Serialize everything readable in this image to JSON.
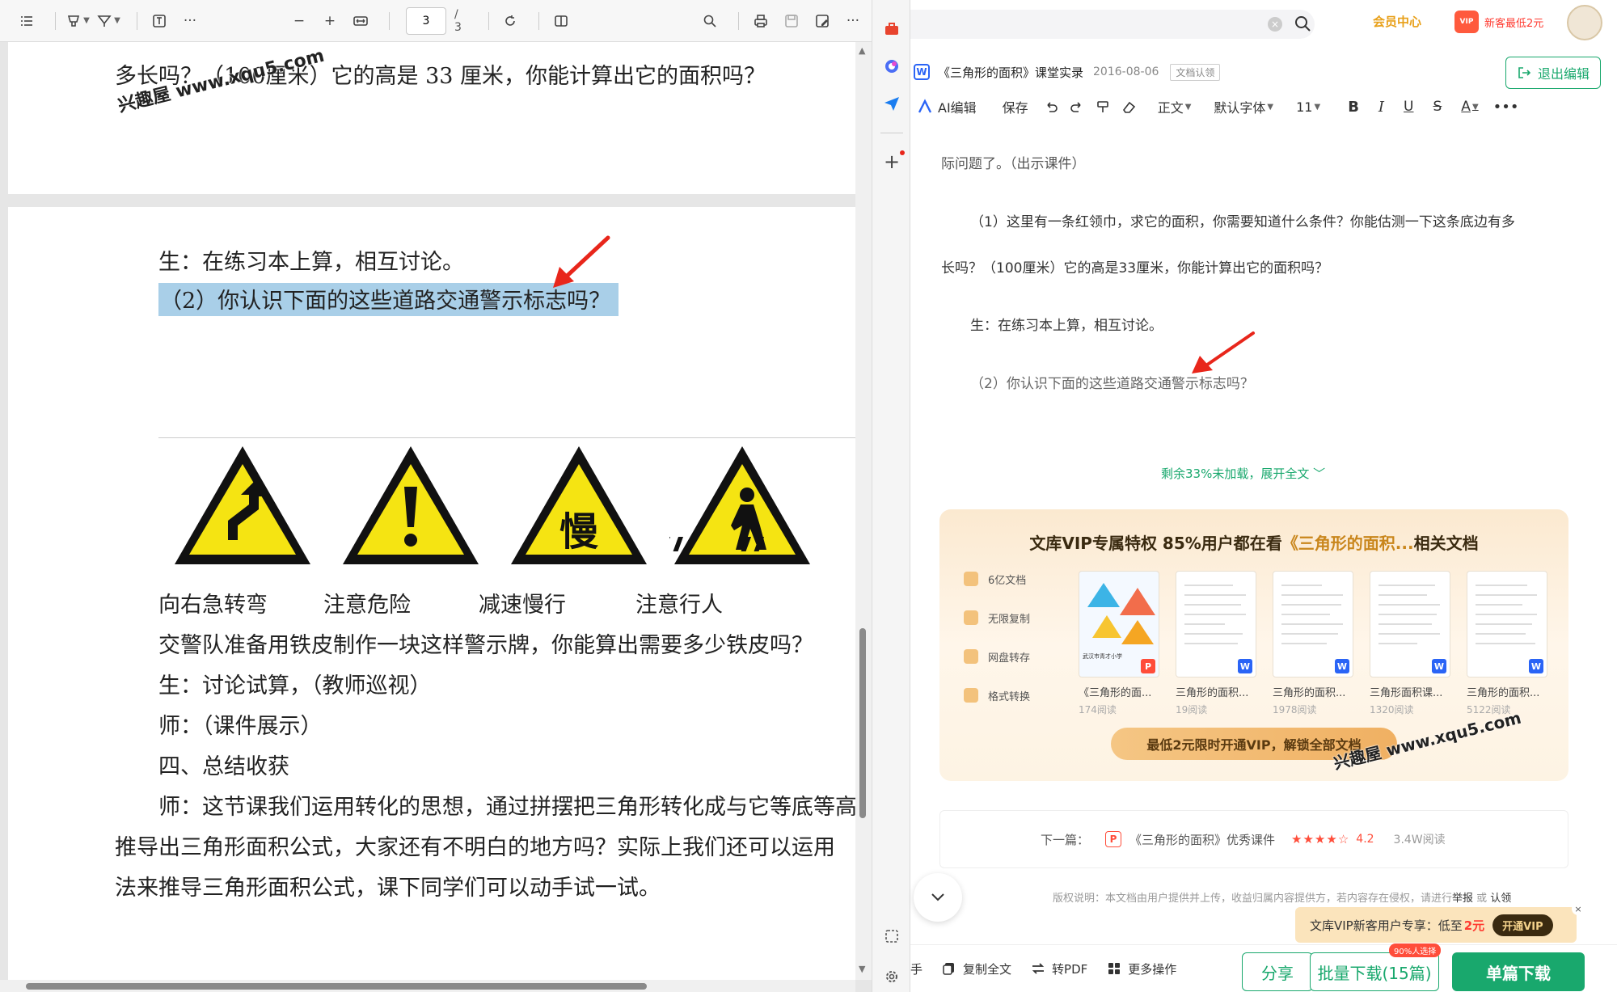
{
  "pdf": {
    "toolbar": {
      "page_value": "3",
      "page_total": "/ 3"
    },
    "page2": {
      "line1": "多长吗？（100厘米）它的高是 33 厘米，你能计算出它的面积吗？"
    },
    "page3": {
      "l1": "生：在练习本上算，相互讨论。",
      "l2": "（2）你认识下面的这些道路交通警示标志吗？",
      "sign_labels": [
        "向右急转弯",
        "注意危险",
        "减速慢行",
        "注意行人"
      ],
      "sign_slow_char": "慢",
      "l3": "交警队准备用铁皮制作一块这样警示牌，你能算出需要多少铁皮吗？",
      "l4": "生：讨论试算，（教师巡视）",
      "l5": "师：（课件展示）",
      "l6": "四、总结收获",
      "l7": "师：这节课我们运用转化的思想，通过拼摆把三角形转化成与它等底等高",
      "l8": "推导出三角形面积公式，大家还有不明白的地方吗？实际上我们还可以运用",
      "l9": "法来推导三角形面积公式，课下同学们可以动手试一试。"
    }
  },
  "watermark": {
    "text1": "兴趣屋 www.xqu5.com",
    "text2": "兴趣屋 www.xqu5.com"
  },
  "web": {
    "header": {
      "member_center": "会员中心",
      "vip_badge": "VIP",
      "new_user": "新客最低2元"
    },
    "doc": {
      "title": "《三角形的面积》课堂实录",
      "date": "2016-08-06",
      "auth": "文档认领",
      "exit_edit": "退出编辑"
    },
    "editbar": {
      "ai_edit": "AI编辑",
      "save": "保存",
      "style": "正文",
      "font": "默认字体",
      "size": "11"
    },
    "content": {
      "p0": "际问题了。（出示课件）",
      "p1": "（1）这里有一条红领巾，求它的面积，你需要知道什么条件？你能估测一下这条底边有多",
      "p2": "长吗？（100厘米）它的高是33厘米，你能计算出它的面积吗？",
      "p3": "生：在练习本上算，相互讨论。",
      "p4": "（2）你认识下面的这些道路交通警示标志吗？",
      "load_more": "剩余33%未加载，展开全文 ﹀"
    },
    "vip_card": {
      "title_prefix": "文库VIP专属特权 85%用户都在看",
      "title_highlight": "《三角形的面积...",
      "title_suffix": "相关文档",
      "perks": [
        "6亿文档",
        "无限复制",
        "网盘转存",
        "格式转换"
      ],
      "thumb_school": "武汉市青才小学",
      "docs": [
        {
          "title": "《三角形的面...",
          "reads": "174阅读",
          "fmt": "P"
        },
        {
          "title": "三角形的面积...",
          "reads": "19阅读",
          "fmt": "W"
        },
        {
          "title": "三角形的面积...",
          "reads": "1978阅读",
          "fmt": "W"
        },
        {
          "title": "三角形面积课...",
          "reads": "1320阅读",
          "fmt": "W"
        },
        {
          "title": "三角形的面积...",
          "reads": "5122阅读",
          "fmt": "W"
        }
      ],
      "cta": "最低2元限时开通VIP，解锁全部文档"
    },
    "next": {
      "label": "下一篇：",
      "title": "《三角形的面积》优秀课件",
      "stars": "★★★★☆",
      "rating": "4.2",
      "reads": "3.4W阅读"
    },
    "copyright": {
      "text": "版权说明：本文档由用户提供并上传，收益归属内容提供方，若内容存在侵权，请进行",
      "report": "举报",
      "or": " 或 ",
      "claim": "认领"
    },
    "promo": {
      "prefix": "文库VIP新客用户专享：低至",
      "price": "2元",
      "btn": "开通VIP",
      "close": "×"
    },
    "bottombar": {
      "assistant": "手",
      "copy_all": "复制全文",
      "to_pdf": "转PDF",
      "more": "更多操作",
      "share": "分享",
      "batch": "批量下载(15篇)",
      "batch_badge": "90%人选择",
      "single": "单篇下载"
    }
  },
  "colors": {
    "accent_green": "#19a86d",
    "highlight": "#a9cfe8",
    "sign_yellow": "#f5e412",
    "arrow_red": "#e8261b"
  }
}
